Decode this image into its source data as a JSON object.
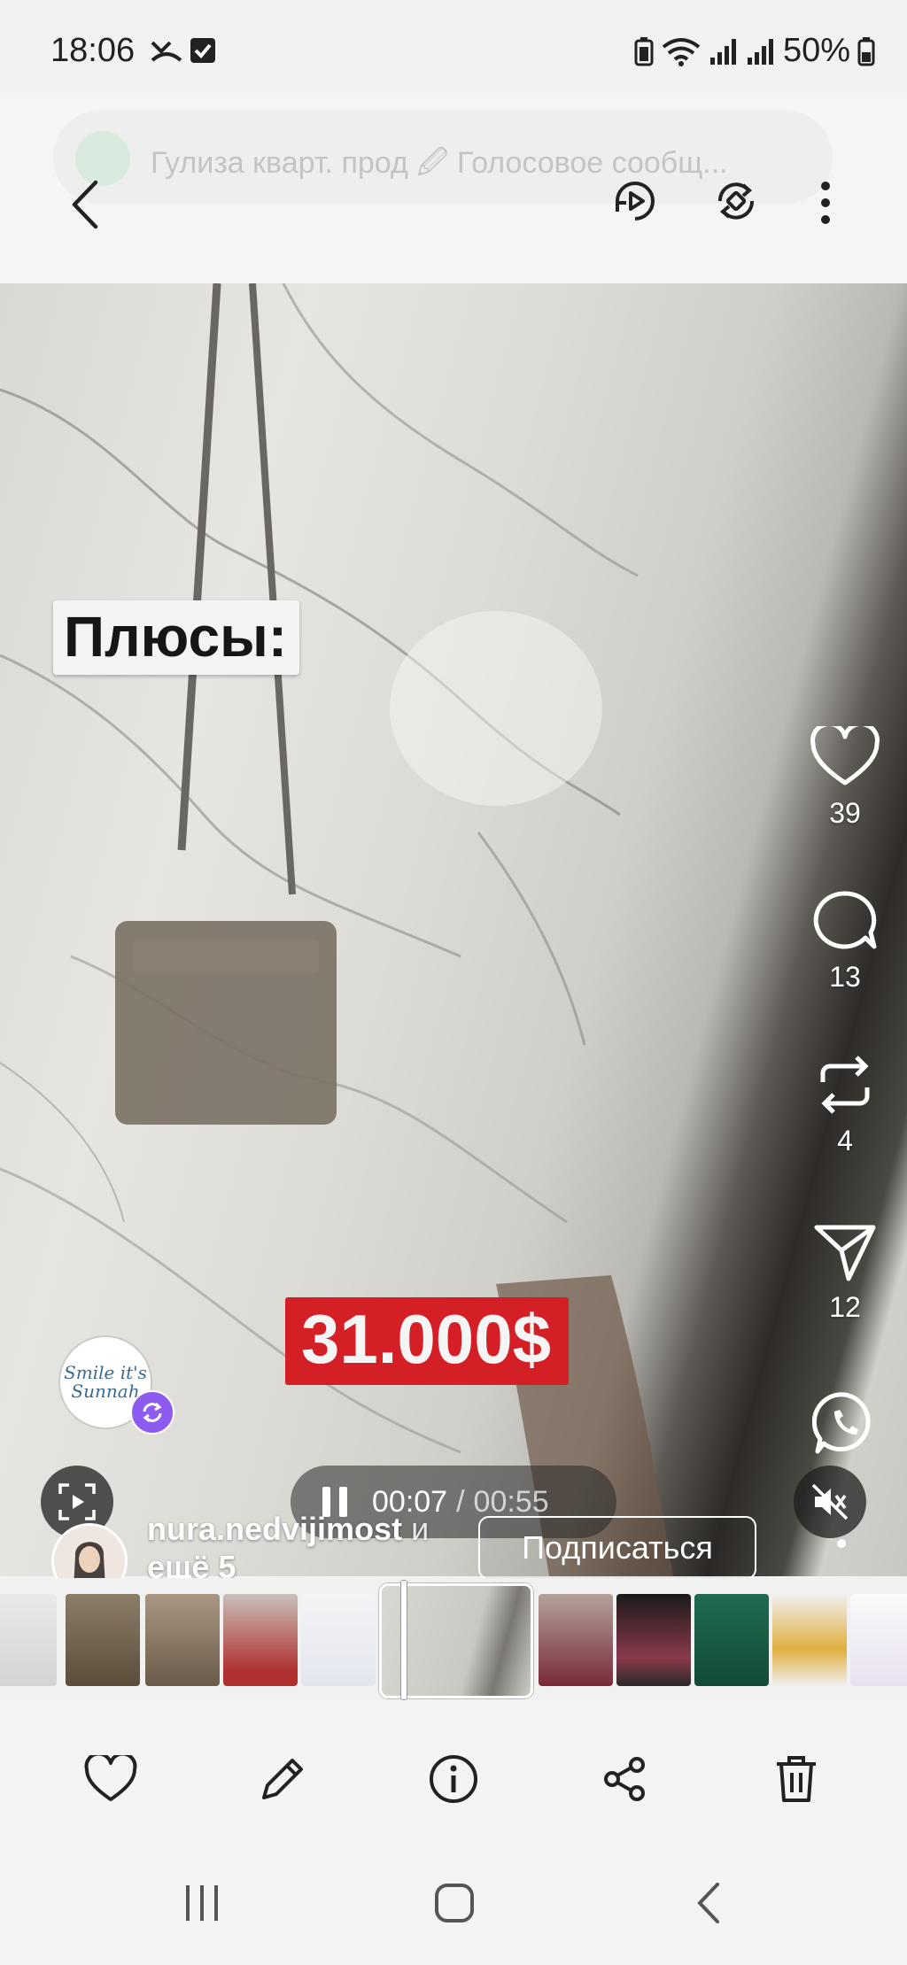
{
  "status_bar": {
    "time": "18:06",
    "battery": "50%"
  },
  "background_notification": {
    "text": "Гулиза кварт. прод 🖉 Голосовое сообщ..."
  },
  "top_bar": {
    "back_icon": "chevron-left-icon",
    "actions": [
      "motion-photo-icon",
      "rotate-icon",
      "more-vertical-icon"
    ]
  },
  "video": {
    "overlay_label": "Плюсы:",
    "price_label": "31.000$"
  },
  "side_rail": {
    "like_count": "39",
    "comment_count": "13",
    "repost_count": "4",
    "share_count": "12"
  },
  "player": {
    "current_time": "00:07",
    "separator": "/",
    "duration": "00:55"
  },
  "author": {
    "username": "nura.nedvijimost",
    "suffix": " и",
    "line2": "ещё 5",
    "follow_label": "Подписаться",
    "badge_avatar_text": "Smile it's Sunnah"
  },
  "bottom_actions": {
    "items": [
      "heart-icon",
      "pencil-icon",
      "info-icon",
      "share-icon",
      "trash-icon"
    ]
  },
  "colors": {
    "price_red": "#d41f26",
    "repost_purple": "#8e5bf0"
  }
}
